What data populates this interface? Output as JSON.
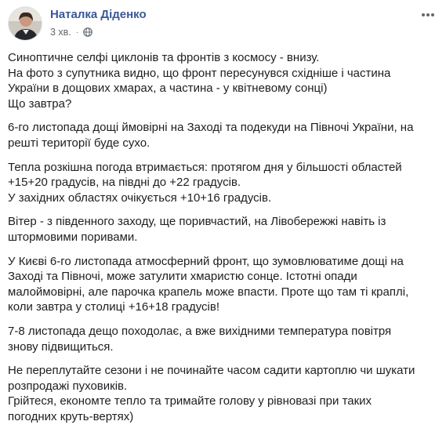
{
  "post": {
    "author": "Наталка Діденко",
    "time": "3 хв.",
    "dot": "·",
    "more_icon": "more-options-icon",
    "privacy_icon": "globe-icon",
    "paragraphs": [
      [
        "Синоптичне селфі циклонів та фронтів з космосу - внизу.",
        "На фото з супутника видно, що фронт пересунувся східніше і частина",
        "України в дощових хмарах, а частина - у квітневому сонці)",
        "Що завтра?"
      ],
      [
        "6-го листопада дощі ймовірні на Заході та подекуди на Півночі України, на",
        "решті території буде сухо."
      ],
      [
        "Тепла розкішна погода втримається: протягом дня у більшості областей",
        "+15+20 градусів, на півдні до +22 градусів.",
        "У західних областях очікується +10+16 градусів."
      ],
      [
        "Вітер - з південного заходу, ще поривчастий, на Лівобережжі навіть із",
        "штормовими поривами."
      ],
      [
        "У Києві 6-го листопада атмосферний фронт, що зумовлюватиме дощі на",
        "Заході та Півночі, може затулити хмаристю сонце. Істотні опади",
        "малоймовірні, але парочка крапель може впасти. Проте що там ті краплі,",
        "коли завтра у столиці +16+18 градусів!"
      ],
      [
        "7-8 листопада дещо походолає, а вже вихідними температура повітря",
        "знову підвищиться."
      ],
      [
        "Не переплутайте сезони і не починайте часом садити картоплю чи шукати",
        "розпродажі пуховиків.",
        "Грійтеся, економте тепло та тримайте голову у рівновазі при таких",
        "погодних круть-вертях)"
      ]
    ]
  },
  "colors": {
    "author": "#385898",
    "meta": "#606770",
    "text": "#1c1e21"
  }
}
